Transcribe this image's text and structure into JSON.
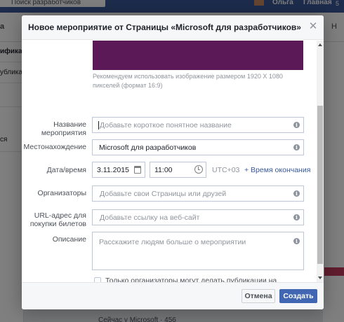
{
  "background": {
    "search_text": "Поиск разработчиков",
    "user_name": "Ольга",
    "home_link": "Главная",
    "home_count": "5",
    "nav_label": "а",
    "nav_right": "Н",
    "side_items": [
      "ификац",
      "ублика",
      "ся"
    ],
    "bottom_text": "Сейчас у Microsoft · 456"
  },
  "dialog": {
    "title": "Новое мероприятие от Страницы «Microsoft для разработчиков»",
    "close_icon": "close-icon",
    "cover_color": "#5b1a57",
    "hint": "Рекомендуем использовать изображение размером 1920 X 1080 пикселей (формат 16:9)",
    "fields": {
      "name": {
        "label": "Название мероприятия",
        "placeholder": "Добавьте короткое понятное название"
      },
      "location": {
        "label": "Местонахождение",
        "value": "Microsoft для разработчиков"
      },
      "datetime": {
        "label": "Дата/время",
        "date": "3.11.2015",
        "time": "11:00",
        "timezone": "UTC+03",
        "end_time_link": "+ Время окончания"
      },
      "organizers": {
        "label": "Организаторы",
        "placeholder": "Добавьте свои Страницы или друзей"
      },
      "tickets": {
        "label": "URL-адрес для покупки билетов",
        "placeholder": "Добавьте ссылку на веб-сайт"
      },
      "description": {
        "label": "Описание",
        "placeholder": "Расскажите людям больше о мероприятии"
      }
    },
    "checkbox_label": "Только организаторы могут делать публикации на стене мероприятия.",
    "cancel_label": "Отмена",
    "create_label": "Создать"
  }
}
